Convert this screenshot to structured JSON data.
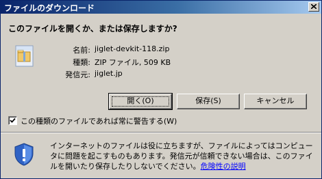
{
  "dialog": {
    "title": "ファイルのダウンロード",
    "question": "このファイルを開くか、または保存しますか?"
  },
  "file_info": [
    {
      "label": "名前:",
      "value": "jiglet-devkit-118.zip"
    },
    {
      "label": "種類:",
      "value": "ZIP ファイル, 509 KB"
    },
    {
      "label": "発信元:",
      "value": "jiglet.jp"
    }
  ],
  "buttons": {
    "open": "開く(O)",
    "save": "保存(S)",
    "cancel": "キャンセル"
  },
  "checkbox": {
    "label": "この種類のファイルであれば常に警告する(W)",
    "checked": true
  },
  "warning": {
    "text": "インターネットのファイルは役に立ちますが、ファイルによってはコンピュータに問題を起こすものもあります。発信元が信頼できない場合は、このファイルを開いたり保存したりしないでください。",
    "link": "危険性の説明"
  },
  "icons": {
    "file": "zip-file-icon",
    "warning": "security-shield-icon",
    "close": "close-icon"
  }
}
